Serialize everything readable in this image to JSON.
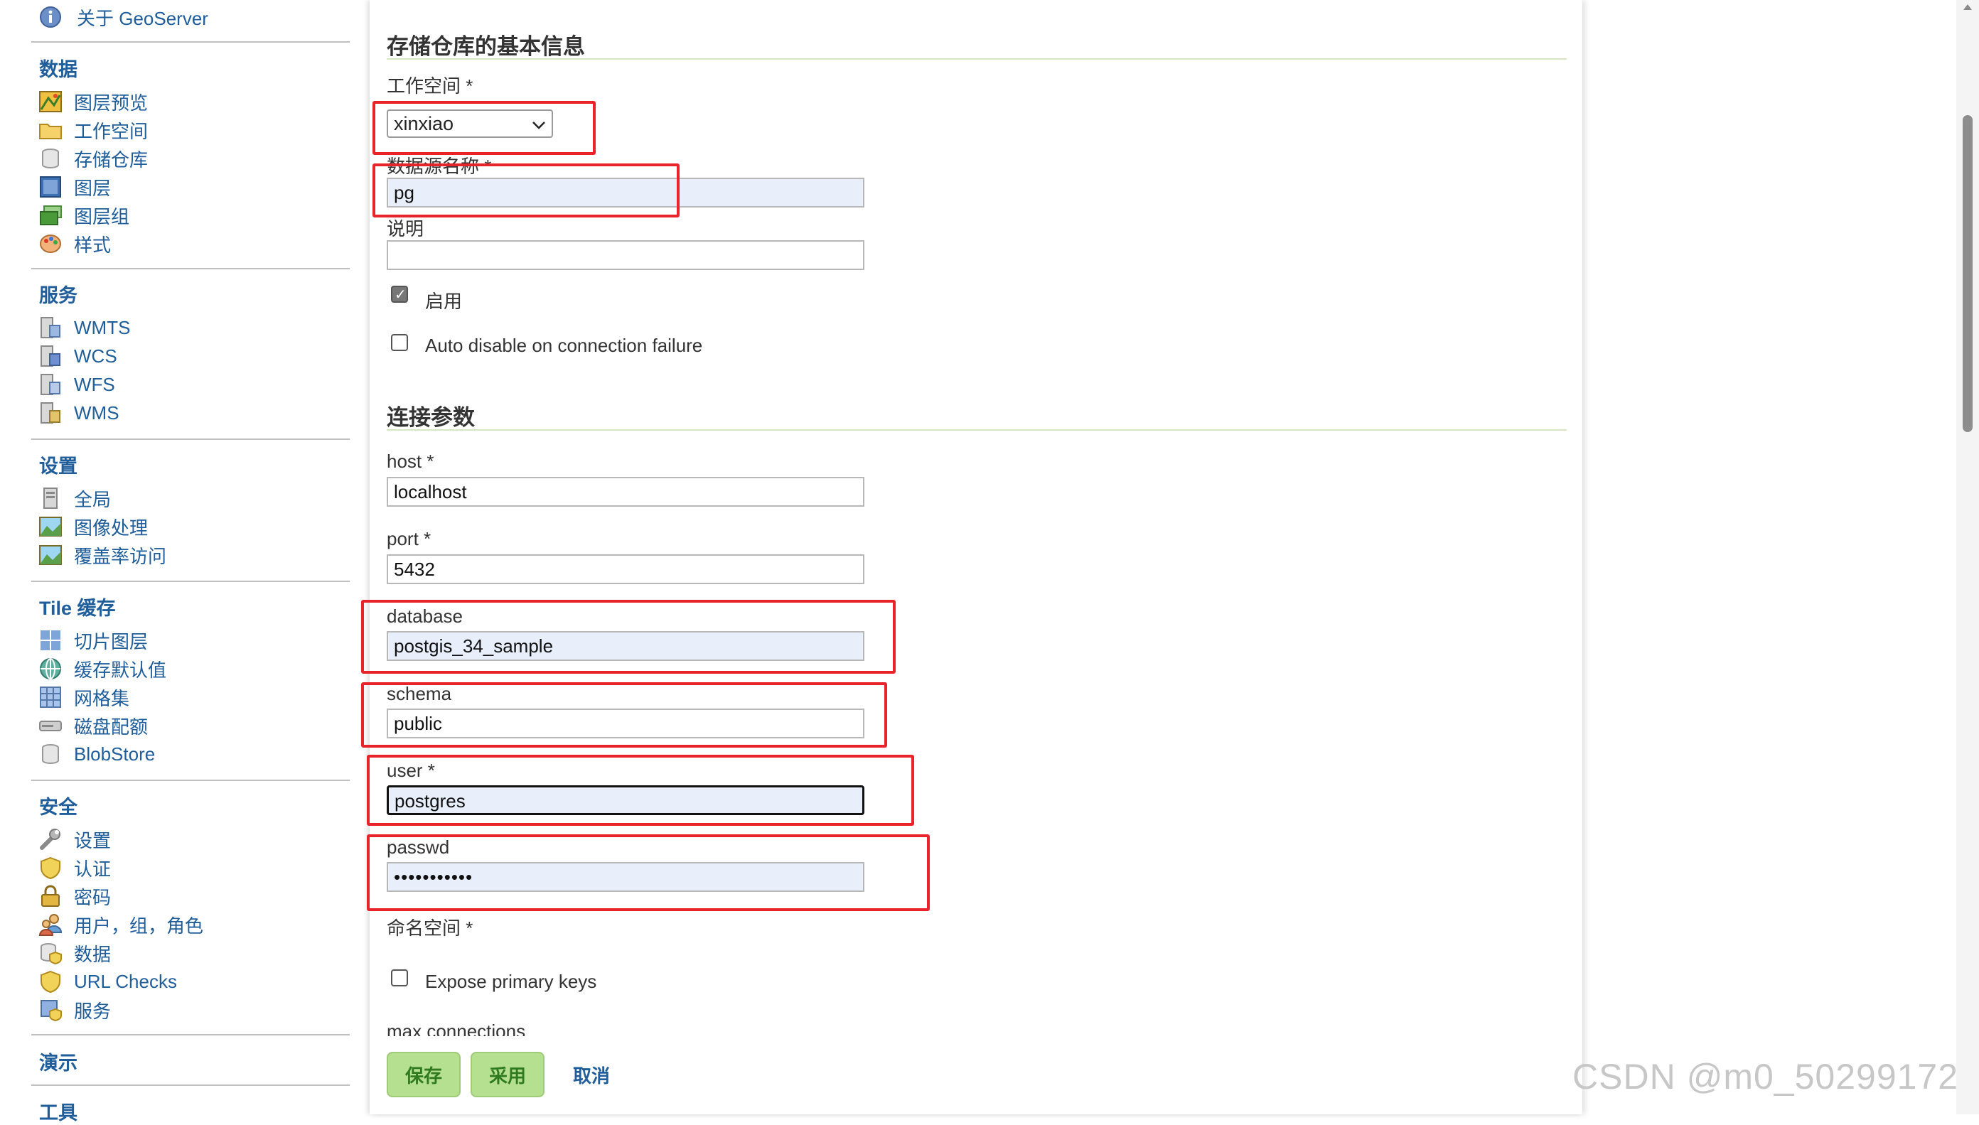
{
  "sidebar": {
    "about": "关于 GeoServer",
    "sections": [
      {
        "title": "数据",
        "items": [
          {
            "label": "图层预览",
            "icon": "layer-preview-icon"
          },
          {
            "label": "工作空间",
            "icon": "folder-icon"
          },
          {
            "label": "存储仓库",
            "icon": "database-icon"
          },
          {
            "label": "图层",
            "icon": "layer-icon"
          },
          {
            "label": "图层组",
            "icon": "layer-group-icon"
          },
          {
            "label": "样式",
            "icon": "palette-icon"
          }
        ]
      },
      {
        "title": "服务",
        "items": [
          {
            "label": "WMTS",
            "icon": "wmts-service-icon"
          },
          {
            "label": "WCS",
            "icon": "wcs-service-icon"
          },
          {
            "label": "WFS",
            "icon": "wfs-service-icon"
          },
          {
            "label": "WMS",
            "icon": "wms-service-icon"
          }
        ]
      },
      {
        "title": "设置",
        "items": [
          {
            "label": "全局",
            "icon": "server-icon"
          },
          {
            "label": "图像处理",
            "icon": "image-processing-icon"
          },
          {
            "label": "覆盖率访问",
            "icon": "coverage-access-icon"
          }
        ]
      },
      {
        "title": "Tile 缓存",
        "items": [
          {
            "label": "切片图层",
            "icon": "tile-layers-icon"
          },
          {
            "label": "缓存默认值",
            "icon": "globe-icon"
          },
          {
            "label": "网格集",
            "icon": "grid-icon"
          },
          {
            "label": "磁盘配额",
            "icon": "disk-icon"
          },
          {
            "label": "BlobStore",
            "icon": "database-icon"
          }
        ]
      },
      {
        "title": "安全",
        "items": [
          {
            "label": "设置",
            "icon": "wrench-icon"
          },
          {
            "label": "认证",
            "icon": "shield-icon"
          },
          {
            "label": "密码",
            "icon": "lock-icon"
          },
          {
            "label": "用户，组，角色",
            "icon": "users-icon"
          },
          {
            "label": "数据",
            "icon": "data-security-icon"
          },
          {
            "label": "URL Checks",
            "icon": "shield-icon"
          },
          {
            "label": "服务",
            "icon": "service-security-icon"
          }
        ]
      },
      {
        "title": "演示",
        "items": []
      },
      {
        "title": "工具",
        "items": []
      }
    ]
  },
  "form": {
    "basic_title": "存储仓库的基本信息",
    "workspace_label": "工作空间 *",
    "workspace_value": "xinxiao",
    "datasource_label": "数据源名称 *",
    "datasource_value": "pg",
    "description_label": "说明",
    "description_value": "",
    "enabled_label": "启用",
    "enabled_checked": true,
    "auto_disable_label": "Auto disable on connection failure",
    "auto_disable_checked": false,
    "conn_title": "连接参数",
    "host_label": "host *",
    "host_value": "localhost",
    "port_label": "port *",
    "port_value": "5432",
    "database_label": "database",
    "database_value": "postgis_34_sample",
    "schema_label": "schema",
    "schema_value": "public",
    "user_label": "user *",
    "user_value": "postgres",
    "passwd_label": "passwd",
    "passwd_value": "•••••••••••",
    "namespace_label": "命名空间 *",
    "expose_pk_label": "Expose primary keys",
    "expose_pk_checked": false,
    "max_connections_label": "max connections"
  },
  "buttons": {
    "save": "保存",
    "apply": "采用",
    "cancel": "取消"
  },
  "watermark": "CSDN @m0_50299172",
  "colors": {
    "link": "#1f5d9b",
    "button_bg": "#b5e08f",
    "highlight_box": "#e8232a",
    "filled_input": "#e8effb"
  }
}
